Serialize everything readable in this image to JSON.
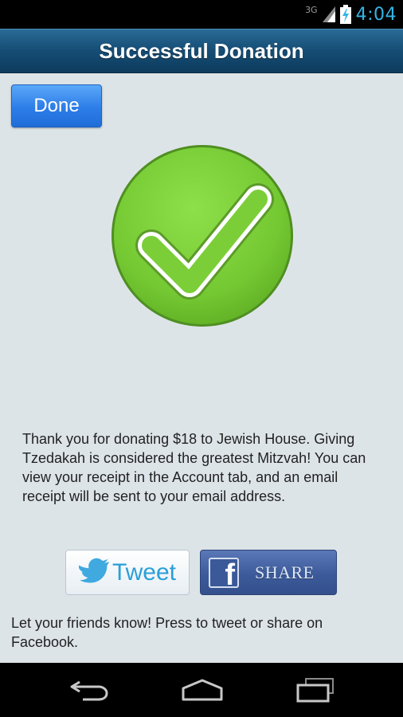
{
  "status_bar": {
    "network": "3G",
    "time": "4:04",
    "clock_color": "#33b5e5"
  },
  "title_bar": {
    "title": "Successful Donation"
  },
  "content": {
    "done_label": "Done",
    "message": "Thank you for donating $18 to Jewish House. Giving Tzedakah is considered the greatest Mitzvah! You can view your receipt in the Account tab, and an email receipt will be sent to your email address.",
    "tweet_label": "Tweet",
    "share_label": "SHARE",
    "facebook_letter": "f",
    "friends_prompt": "Let your friends know! Press to tweet or share on Facebook.",
    "success_color": "#7ed13a",
    "success_icon": "check-circle-icon"
  },
  "nav_bar": {
    "icons": [
      "back-icon",
      "home-icon",
      "recent-apps-icon"
    ]
  }
}
